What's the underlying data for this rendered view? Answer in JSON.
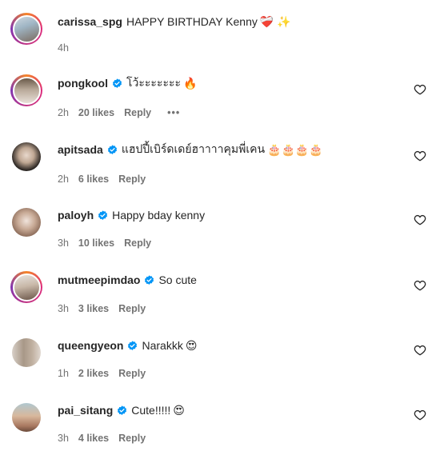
{
  "comments": [
    {
      "username": "carissa_spg",
      "verified": false,
      "text": "HAPPY BIRTHDAY Kenny",
      "emoji": "❤️‍🩹 ✨",
      "time": "4h",
      "likes": "",
      "reply": "",
      "has_heart": false,
      "ring": true
    },
    {
      "username": "pongkool",
      "verified": true,
      "text": "โว้ะะะะะะะ",
      "emoji": "🔥",
      "time": "2h",
      "likes": "20 likes",
      "reply": "Reply",
      "more": "•••",
      "has_heart": true,
      "ring": true
    },
    {
      "username": "apitsada",
      "verified": true,
      "text": "แฮปปี้เบิร์ดเดย์ฮาาาาคุมพี่เคน",
      "emoji": "🎂🎂🎂🎂",
      "time": "2h",
      "likes": "6 likes",
      "reply": "Reply",
      "has_heart": true,
      "ring": false
    },
    {
      "username": "paloyh",
      "verified": true,
      "text": "Happy bday kenny",
      "emoji": "",
      "time": "3h",
      "likes": "10 likes",
      "reply": "Reply",
      "has_heart": true,
      "ring": false
    },
    {
      "username": "mutmeepimdao",
      "verified": true,
      "text": "So cute",
      "emoji": "",
      "time": "3h",
      "likes": "3 likes",
      "reply": "Reply",
      "has_heart": true,
      "ring": true
    },
    {
      "username": "queengyeon",
      "verified": true,
      "text": "Narakkk",
      "emoji": "😍",
      "time": "1h",
      "likes": "2 likes",
      "reply": "Reply",
      "has_heart": true,
      "ring": false
    },
    {
      "username": "pai_sitang",
      "verified": true,
      "text": "Cute!!!!!",
      "emoji": "😍",
      "time": "3h",
      "likes": "4 likes",
      "reply": "Reply",
      "has_heart": true,
      "ring": false
    }
  ],
  "colors": {
    "verified": "#0095f6",
    "muted": "#737373",
    "text": "#262626"
  }
}
